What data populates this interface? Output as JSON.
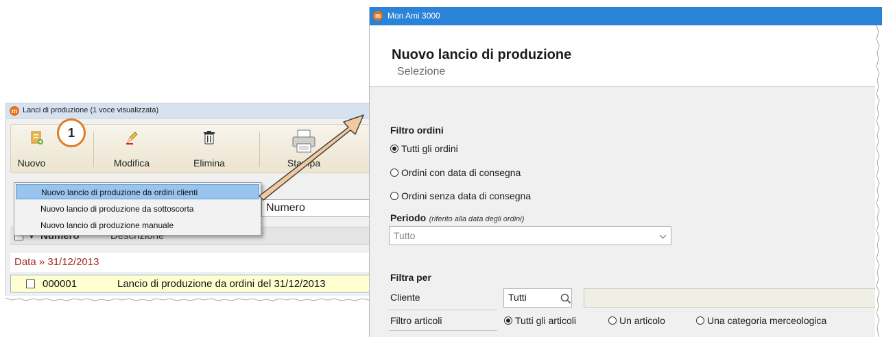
{
  "left_window": {
    "title": "Lanci di produzione (1 voce visualizzata)",
    "logo": "m",
    "toolbar": {
      "new_label": "Nuovo",
      "edit_label": "Modifica",
      "delete_label": "Elimina",
      "print_label": "Stampa"
    },
    "dropdown": {
      "items": [
        "Nuovo lancio di produzione da ordini clienti",
        "Nuovo lancio di produzione da sottoscorta",
        "Nuovo lancio di produzione manuale"
      ],
      "selected_index": 0
    },
    "search_value": "Numero",
    "table": {
      "columns": [
        "Numero",
        "Descrizione"
      ],
      "sort_indicator": "▾",
      "group_header": "Data » 31/12/2013",
      "rows": [
        {
          "numero": "000001",
          "descrizione": "Lancio di produzione da ordini del 31/12/2013"
        }
      ]
    }
  },
  "callout_number": "1",
  "right_window": {
    "title": "Mon Ami 3000",
    "logo": "m",
    "heading": "Nuovo lancio di produzione",
    "subheading": "Selezione",
    "filtro_ordini": {
      "title": "Filtro ordini",
      "options": [
        {
          "label": "Tutti gli ordini",
          "checked": true
        },
        {
          "label": "Ordini con data di consegna",
          "checked": false
        },
        {
          "label": "Ordini senza data di consegna",
          "checked": false
        }
      ]
    },
    "periodo": {
      "title": "Periodo",
      "hint": "(riferito alla data degli ordini)",
      "value": "Tutto"
    },
    "filtra_per": {
      "title": "Filtra per",
      "cliente_label": "Cliente",
      "cliente_value": "Tutti",
      "articoli_label": "Filtro articoli",
      "articoli_options": [
        {
          "label": "Tutti gli articoli",
          "checked": true
        },
        {
          "label": "Un articolo",
          "checked": false
        },
        {
          "label": "Una categoria merceologica",
          "checked": false
        }
      ]
    }
  },
  "colors": {
    "accent_blue": "#2b83d8",
    "callout_orange": "#e07c22",
    "menu_selection": "#99c4ee",
    "group_header_red": "#a2282a",
    "row_highlight": "#ffffcf"
  }
}
